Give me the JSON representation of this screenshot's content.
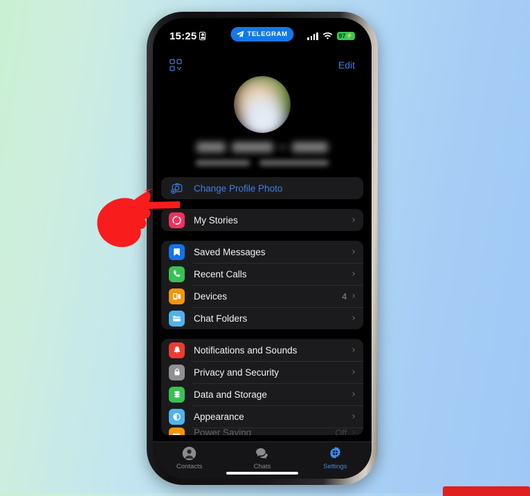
{
  "scene": {
    "background_gradient_from": "#c9f0d2",
    "background_gradient_to": "#9fc8f6",
    "pointer_target": "my-stories-row",
    "pointer_color": "#f81c1c",
    "bottom_red_bar_color": "#e02020"
  },
  "status_bar": {
    "time": "15:25",
    "lock_icon": "id-card-icon",
    "island_app_label": "TELEGRAM",
    "island_icon": "telegram-plane-icon",
    "island_color": "#1479e8",
    "signal_icon": "cellular-bars-icon",
    "wifi_icon": "wifi-icon",
    "battery_percent": "97",
    "battery_charging_glyph": "⚡",
    "battery_color": "#35c759"
  },
  "nav": {
    "qr_icon": "qr-code-icon",
    "edit_label": "Edit",
    "accent": "#3e7fe0"
  },
  "profile": {
    "avatar": "user-avatar-blurred",
    "name_redacted": true,
    "subtitle_redacted": true
  },
  "groups": [
    {
      "name": "profile-actions-group",
      "rows": [
        {
          "label": "Change Profile Photo",
          "icon": "camera-add-icon",
          "label_style": "blue",
          "icon_bg": "transparent",
          "value": "",
          "chevron": false
        }
      ]
    },
    {
      "name": "stories-group",
      "rows": [
        {
          "label": "My Stories",
          "icon": "story-circle-icon",
          "label_style": "plain",
          "icon_bg": "#f2305e",
          "value": "",
          "chevron": true
        }
      ]
    },
    {
      "name": "account-group",
      "rows": [
        {
          "label": "Saved Messages",
          "icon": "bookmark-icon",
          "label_style": "plain",
          "icon_bg": "#1273e8",
          "value": "",
          "chevron": true
        },
        {
          "label": "Recent Calls",
          "icon": "phone-icon",
          "label_style": "plain",
          "icon_bg": "#37c253",
          "value": "",
          "chevron": true
        },
        {
          "label": "Devices",
          "icon": "devices-icon",
          "label_style": "plain",
          "icon_bg": "#f2960d",
          "value": "4",
          "chevron": true
        },
        {
          "label": "Chat Folders",
          "icon": "folder-icon",
          "label_style": "plain",
          "icon_bg": "#4fb3e8",
          "value": "",
          "chevron": true
        }
      ]
    },
    {
      "name": "settings-group",
      "rows": [
        {
          "label": "Notifications and Sounds",
          "icon": "bell-icon",
          "label_style": "plain",
          "icon_bg": "#ec3b33",
          "value": "",
          "chevron": true
        },
        {
          "label": "Privacy and Security",
          "icon": "lock-icon",
          "label_style": "plain",
          "icon_bg": "#8f8f94",
          "value": "",
          "chevron": true
        },
        {
          "label": "Data and Storage",
          "icon": "database-icon",
          "label_style": "plain",
          "icon_bg": "#37c253",
          "value": "",
          "chevron": true
        },
        {
          "label": "Appearance",
          "icon": "contrast-circle-icon",
          "label_style": "plain",
          "icon_bg": "#4fb3e8",
          "value": "",
          "chevron": true
        },
        {
          "label": "Power Saving",
          "icon": "battery-saver-icon",
          "label_style": "plain",
          "icon_bg": "#f2960d",
          "value": "Off",
          "chevron": true,
          "clipped": true
        }
      ]
    }
  ],
  "tabbar": {
    "tabs": [
      {
        "label": "Contacts",
        "icon": "person-circle-icon",
        "active": false
      },
      {
        "label": "Chats",
        "icon": "chat-bubbles-icon",
        "active": false
      },
      {
        "label": "Settings",
        "icon": "gear-icon",
        "active": true
      }
    ],
    "active_color": "#3e8ae8",
    "inactive_color": "#8b8b90"
  }
}
